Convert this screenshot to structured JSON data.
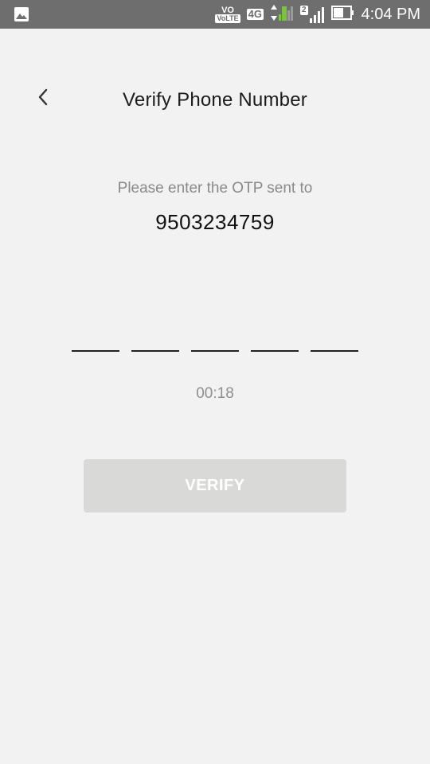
{
  "status_bar": {
    "time": "4:04 PM",
    "network_type": "4G",
    "volte": "VoLTE",
    "sim2_indicator": "2",
    "icons": [
      "image-icon",
      "volte-icon",
      "network-4g-icon",
      "data-arrows-icon",
      "signal-icon",
      "battery-icon"
    ]
  },
  "header": {
    "title": "Verify Phone Number",
    "back_icon": "chevron-left-icon"
  },
  "message": {
    "prompt": "Please enter the OTP sent to",
    "phone_number": "9503234759"
  },
  "otp": {
    "digits": [
      "",
      "",
      "",
      "",
      ""
    ]
  },
  "timer": "00:18",
  "verify_button": {
    "label": "VERIFY",
    "enabled": false
  },
  "colors": {
    "status_bar_bg": "#6e6e6e",
    "background": "#f2f2f2",
    "button_disabled_bg": "#d9dad8",
    "signal_green": "#7cc142"
  }
}
